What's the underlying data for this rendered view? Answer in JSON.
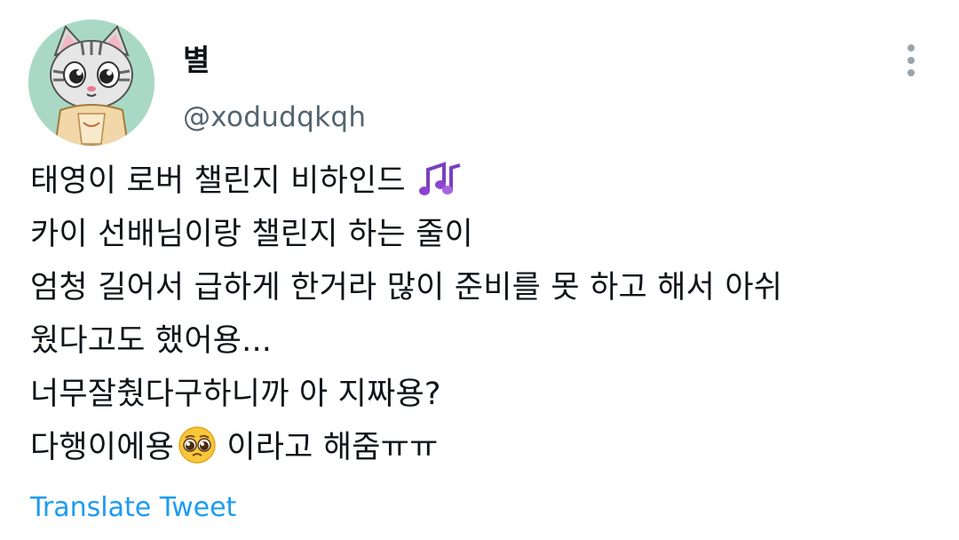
{
  "author": {
    "display_name": "별",
    "handle": "@xodudqkqh",
    "avatar_icon": "cat-avatar-icon"
  },
  "more_icon": "more-vertical-icon",
  "tweet": {
    "lines": [
      "태영이 로버 챌린지 비하인드",
      "카이 선배님이랑 챌린지 하는 줄이",
      "엄청 길어서 급하게 한거라 많이 준비를 못 하고 해서 아쉬",
      "웠다고도 했어용...",
      "너무잘췄다구하니까 아 지짜용?",
      "다행이에용",
      " 이라고 해줌ㅠㅠ"
    ],
    "emoji_1": "musical-notes-emoji",
    "emoji_2": "pleading-face-emoji"
  },
  "translate_label": "Translate Tweet",
  "colors": {
    "link": "#1d9bf0",
    "handle": "#536471",
    "text": "#0f1419"
  }
}
